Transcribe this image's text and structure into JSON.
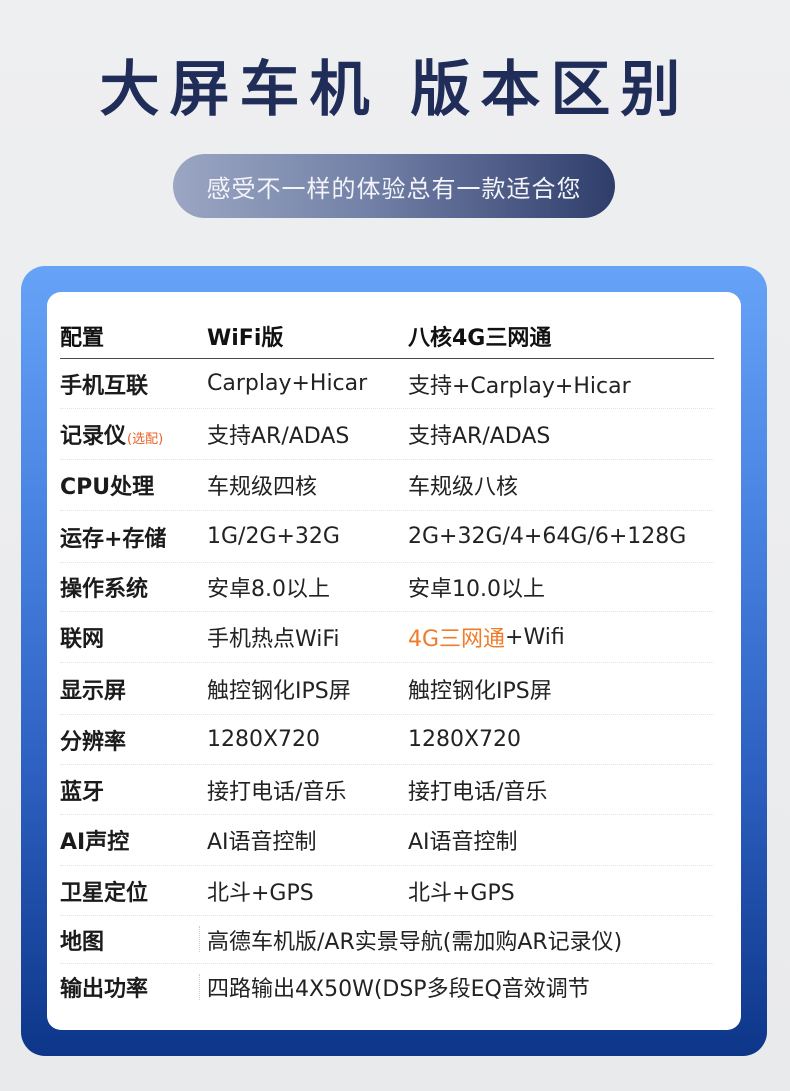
{
  "page": {
    "title": "大屏车机 版本区别",
    "subtitle": "感受不一样的体验总有一款适合您"
  },
  "table": {
    "headers": {
      "col1": "配置",
      "col2": "WiFi版",
      "col3": "八核4G三网通"
    },
    "rows": [
      {
        "feature": "手机互联",
        "note": "",
        "wifi": "Carplay+Hicar",
        "g4": "支持+Carplay+Hicar"
      },
      {
        "feature": "记录仪",
        "note": "(选配)",
        "wifi": "支持AR/ADAS",
        "g4": "支持AR/ADAS"
      },
      {
        "feature": "CPU处理",
        "note": "",
        "wifi": "车规级四核",
        "g4": "车规级八核"
      },
      {
        "feature": "运存+存储",
        "note": "",
        "wifi": "1G/2G+32G",
        "g4": "2G+32G/4+64G/6+128G"
      },
      {
        "feature": "操作系统",
        "note": "",
        "wifi": "安卓8.0以上",
        "g4": "安卓10.0以上"
      },
      {
        "feature": "联网",
        "note": "",
        "wifi": "手机热点WiFi",
        "g4_highlight": "4G三网通",
        "g4": "+Wifi"
      },
      {
        "feature": "显示屏",
        "note": "",
        "wifi": "触控钢化IPS屏",
        "g4": "触控钢化IPS屏"
      },
      {
        "feature": "分辨率",
        "note": "",
        "wifi": "1280X720",
        "g4": "1280X720"
      },
      {
        "feature": "蓝牙",
        "note": "",
        "wifi": "接打电话/音乐",
        "g4": "接打电话/音乐"
      },
      {
        "feature": "AI声控",
        "note": "",
        "wifi": "AI语音控制",
        "g4": "AI语音控制"
      },
      {
        "feature": "卫星定位",
        "note": "",
        "wifi": "北斗+GPS",
        "g4": "北斗+GPS"
      }
    ],
    "wide_rows": [
      {
        "feature": "地图",
        "value": "高德车机版/AR实景导航(需加购AR记录仪)"
      },
      {
        "feature": "输出功率",
        "value": "四路输出4X50W(DSP多段EQ音效调节"
      }
    ]
  },
  "colors": {
    "title": "#1f2d58",
    "highlight": "#f07b2a",
    "card_top": "#66a3f7",
    "card_bottom": "#0d3689"
  }
}
